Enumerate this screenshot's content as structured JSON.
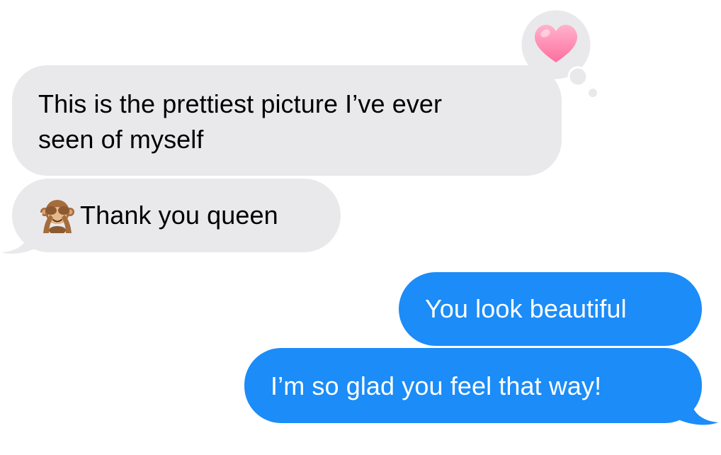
{
  "conversation": {
    "messages": [
      {
        "direction": "received",
        "text": "This is the prettiest picture I’ve ever\nseen of myself",
        "reaction": "heart-icon"
      },
      {
        "direction": "received",
        "emoji": "see-no-evil-monkey-icon",
        "text": "Thank you queen"
      },
      {
        "direction": "sent",
        "text": "You look beautiful"
      },
      {
        "direction": "sent",
        "text": "I’m so glad you feel that way!"
      }
    ]
  },
  "colors": {
    "received_bubble": "#e9e9eb",
    "sent_bubble": "#1b8cf8",
    "received_text": "#000000",
    "sent_text": "#ffffff",
    "heart": "#ff8fb5"
  }
}
